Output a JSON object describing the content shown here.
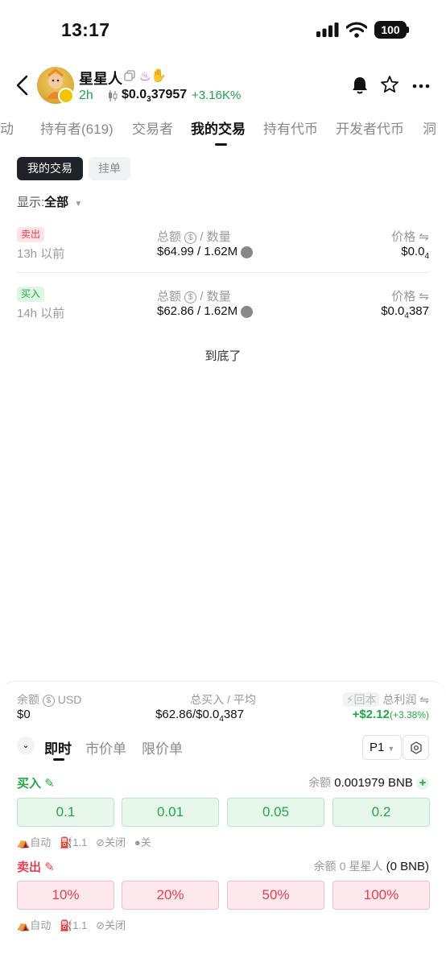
{
  "status_bar": {
    "time": "13:17",
    "battery": "100"
  },
  "token": {
    "name": "星星人",
    "age": "2h",
    "price_prefix": "$0.0",
    "price_sub": "3",
    "price_tail": "37957",
    "change": "+3.16K%"
  },
  "tabs": [
    "动",
    "持有者(619)",
    "交易者",
    "我的交易",
    "持有代币",
    "开发者代币",
    "洞"
  ],
  "active_tab": "我的交易",
  "subtabs": {
    "active": "我的交易",
    "inactive": "挂单"
  },
  "filter": {
    "label": "显示:",
    "value": "全部"
  },
  "trades": [
    {
      "side": "卖出",
      "time": "13h 以前",
      "header_total": "总额",
      "header_qty": "/ 数量",
      "amount": "$64.99 / 1.62M",
      "header_price": "价格",
      "price_prefix": "$0.0",
      "price_sub": "4",
      "price_tail": ""
    },
    {
      "side": "买入",
      "time": "14h 以前",
      "header_total": "总额",
      "header_qty": "/ 数量",
      "amount": "$62.86 / 1.62M",
      "header_price": "价格",
      "price_prefix": "$0.0",
      "price_sub": "4",
      "price_tail": "387"
    }
  ],
  "end_text": "到底了",
  "panel": {
    "balance_label": "余额",
    "balance_unit": "USD",
    "balance_value": "$0",
    "total_buy_label": "总买入 / 平均",
    "total_buy_prefix": "$62.86/$0.0",
    "total_buy_sub": "4",
    "total_buy_tail": "387",
    "return_label": "回本",
    "profit_label": "总利润",
    "profit_value": "+$2.12",
    "profit_pct": "(+3.38%)",
    "modes": [
      "即时",
      "市价单",
      "限价单"
    ],
    "active_mode": "即时",
    "preset": "P1",
    "buy": {
      "label": "买入",
      "balance_label": "余额",
      "balance_value": "0.001979 BNB",
      "amounts": [
        "0.1",
        "0.01",
        "0.05",
        "0.2"
      ],
      "options": [
        "自动",
        "1.1",
        "关闭",
        "关"
      ]
    },
    "sell": {
      "label": "卖出",
      "balance_label": "余额",
      "balance_value": "0 星星人",
      "balance_extra": "(0 BNB)",
      "amounts": [
        "10%",
        "20%",
        "50%",
        "100%"
      ],
      "options": [
        "自动",
        "1.1",
        "关闭"
      ]
    }
  },
  "colors": {
    "green": "#22a844",
    "red": "#e83d4f",
    "dark": "#1f2329"
  }
}
